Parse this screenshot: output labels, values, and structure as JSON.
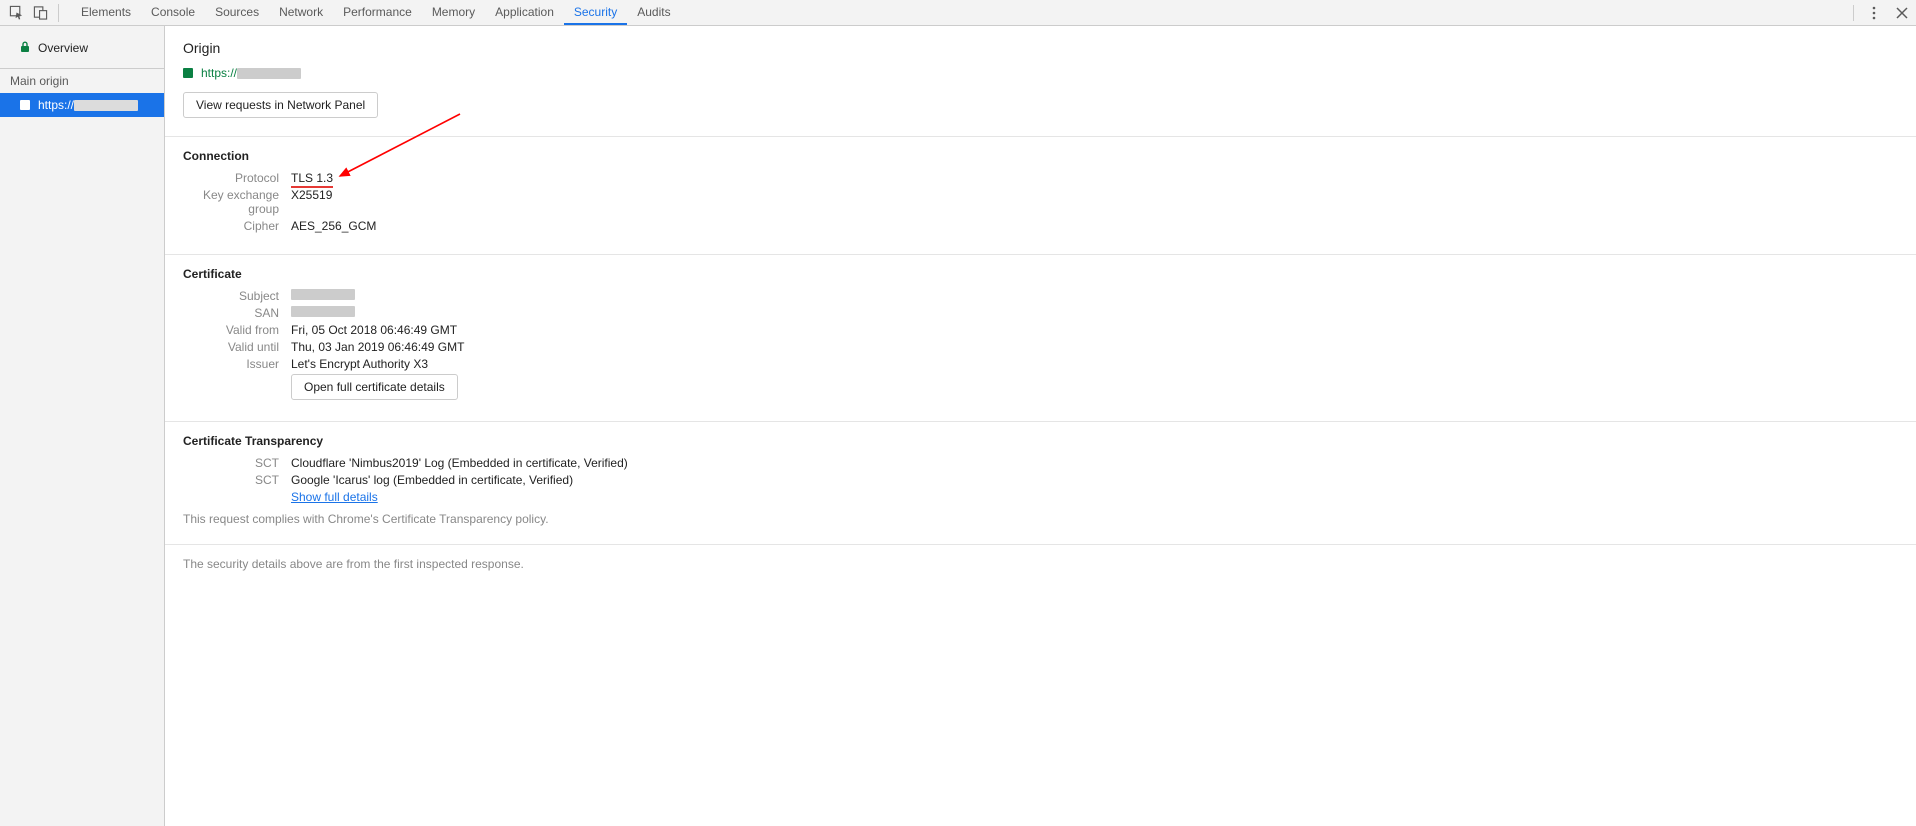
{
  "topbar": {
    "tabs": [
      "Elements",
      "Console",
      "Sources",
      "Network",
      "Performance",
      "Memory",
      "Application",
      "Security",
      "Audits"
    ],
    "active_tab": "Security"
  },
  "sidebar": {
    "overview_label": "Overview",
    "main_origin_label": "Main origin",
    "origin_prefix": "https://"
  },
  "origin": {
    "title": "Origin",
    "prefix": "https://",
    "view_requests_btn": "View requests in Network Panel"
  },
  "connection": {
    "title": "Connection",
    "rows": [
      {
        "k": "Protocol",
        "v": "TLS 1.3"
      },
      {
        "k": "Key exchange group",
        "v": "X25519"
      },
      {
        "k": "Cipher",
        "v": "AES_256_GCM"
      }
    ]
  },
  "certificate": {
    "title": "Certificate",
    "subject_label": "Subject",
    "san_label": "SAN",
    "rows": [
      {
        "k": "Valid from",
        "v": "Fri, 05 Oct 2018 06:46:49 GMT"
      },
      {
        "k": "Valid until",
        "v": "Thu, 03 Jan 2019 06:46:49 GMT"
      },
      {
        "k": "Issuer",
        "v": "Let's Encrypt Authority X3"
      }
    ],
    "open_details_btn": "Open full certificate details"
  },
  "ct": {
    "title": "Certificate Transparency",
    "rows": [
      {
        "k": "SCT",
        "v": "Cloudflare 'Nimbus2019' Log (Embedded in certificate, Verified)"
      },
      {
        "k": "SCT",
        "v": "Google 'Icarus' log (Embedded in certificate, Verified)"
      }
    ],
    "show_full_link": "Show full details",
    "compliance_note": "This request complies with Chrome's Certificate Transparency policy."
  },
  "footer_note": "The security details above are from the first inspected response."
}
